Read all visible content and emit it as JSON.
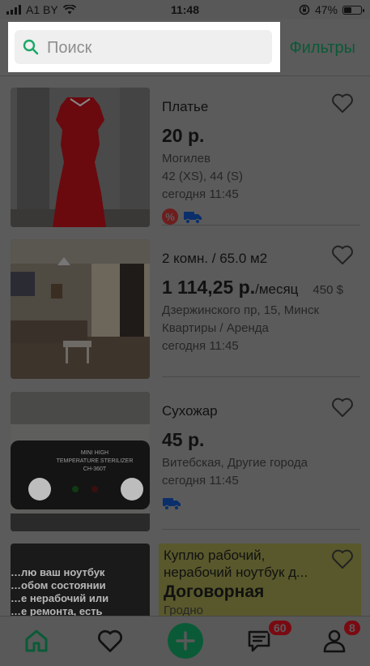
{
  "status_bar": {
    "carrier": "A1 BY",
    "time": "11:48",
    "battery": "47%",
    "battery_level": 0.47
  },
  "search": {
    "placeholder": "Поиск",
    "value": "",
    "icon": "search-icon"
  },
  "header": {
    "filters_label": "Фильтры"
  },
  "listings": [
    {
      "title": "Платье",
      "price": "20 р.",
      "location": "Могилев",
      "size": "42 (XS), 44 (S)",
      "time": "сегодня 11:45",
      "badges": [
        "discount-badge",
        "delivery-badge"
      ]
    },
    {
      "title": "2 комн. / 65.0 м2",
      "price": "1 114,25 р.",
      "price_unit": "/месяц",
      "price_alt": "450 $",
      "address": "Дзержинского пр, 15, Минск",
      "category": "Квартиры / Аренда",
      "time": "сегодня 11:45"
    },
    {
      "title": "Сухожар",
      "price": "45 р.",
      "location": "Витебская, Другие города",
      "time": "сегодня 11:45",
      "badges": [
        "delivery-badge"
      ],
      "image_text": [
        "MINI HIGH",
        "TEMPERATURE STERILIZER",
        "CH-360T"
      ]
    },
    {
      "title": "Куплю рабочий, нерабочий ноутбук д...",
      "price": "Договорная",
      "location": "Гродно",
      "image_text": [
        "…лю ваш ноутбук",
        "…обом состоянии",
        "…е нерабочий или",
        "…е ремонта, есть"
      ]
    }
  ],
  "tabbar": {
    "home_icon": "home-icon",
    "favorites_icon": "heart-icon",
    "add_icon": "plus-icon",
    "messages_icon": "chat-icon",
    "messages_count": "60",
    "profile_icon": "user-icon",
    "profile_count": "8"
  },
  "colors": {
    "accent": "#1aa866",
    "overlay": "#5b5b5b",
    "badge": "#e0202e",
    "highlight": "#ffff9a"
  }
}
